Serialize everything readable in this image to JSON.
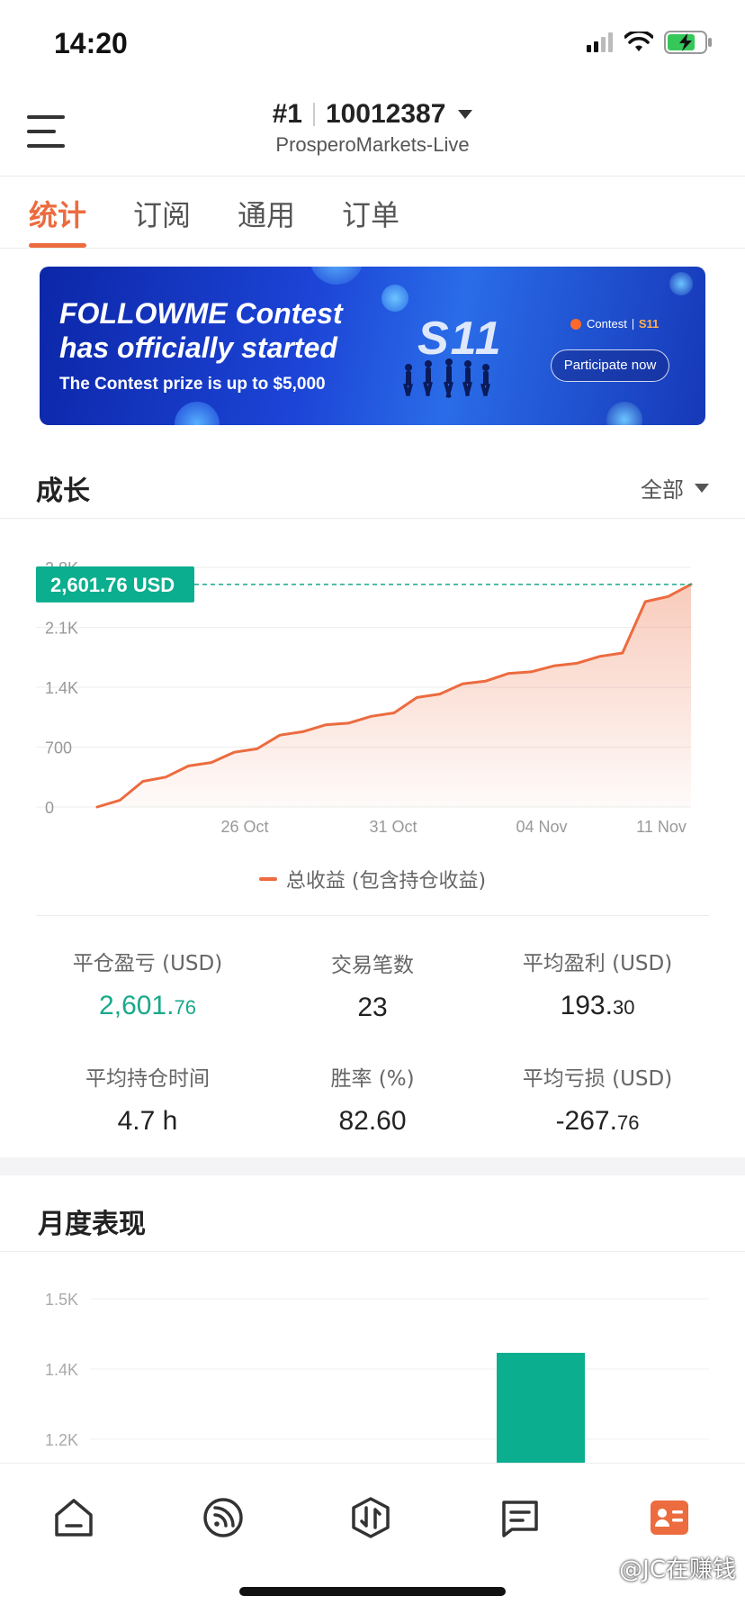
{
  "status_bar": {
    "time": "14:20"
  },
  "header": {
    "rank": "#1",
    "account_id": "10012387",
    "server": "ProsperoMarkets-Live"
  },
  "tabs": [
    {
      "label": "统计",
      "active": true
    },
    {
      "label": "订阅",
      "active": false
    },
    {
      "label": "通用",
      "active": false
    },
    {
      "label": "订单",
      "active": false
    }
  ],
  "banner": {
    "line1": "FOLLOWME Contest",
    "line2": "has officially started",
    "line3": "The Contest prize is up to $5,000",
    "badge_label": "Contest",
    "badge_season": "S11",
    "big_mark": "S11",
    "cta": "Participate now"
  },
  "growth": {
    "title": "成长",
    "filter": "全部",
    "legend": "总收益 (包含持仓收益)"
  },
  "chart_data": [
    {
      "type": "area",
      "y_ticks": [
        "2.8K",
        "2.1K",
        "1.4K",
        "700",
        "0"
      ],
      "y_tick_values": [
        2800,
        2100,
        1400,
        700,
        0
      ],
      "x_ticks": [
        "26 Oct",
        "31 Oct",
        "04 Nov",
        "11 Nov"
      ],
      "ylim": [
        0,
        2800
      ],
      "current_label": "2,601.76 USD",
      "current_value": 2601.76,
      "color": "#ec6b3f",
      "series": [
        {
          "name": "总收益 (包含持仓收益)",
          "values": [
            0,
            80,
            300,
            350,
            480,
            520,
            640,
            680,
            840,
            880,
            960,
            980,
            1060,
            1100,
            1280,
            1320,
            1440,
            1470,
            1560,
            1580,
            1650,
            1680,
            1760,
            1800,
            2400,
            2460,
            2601.76
          ]
        }
      ]
    },
    {
      "type": "bar",
      "y_ticks": [
        "1.5K",
        "1.4K",
        "1.2K"
      ],
      "y_tick_values": [
        1500,
        1400,
        1200
      ],
      "ylim": [
        1150,
        1550
      ],
      "color": "#0bae8e",
      "values": [
        1430
      ]
    }
  ],
  "stats": {
    "closed_pnl": {
      "label": "平仓盈亏 (USD)",
      "int": "2,601.",
      "frac": "76"
    },
    "trade_count": {
      "label": "交易笔数",
      "value": "23"
    },
    "avg_profit": {
      "label": "平均盈利 (USD)",
      "int": "193.",
      "frac": "30"
    },
    "avg_hold": {
      "label": "平均持仓时间",
      "value": "4.7 h"
    },
    "win_rate": {
      "label": "胜率 (%)",
      "value": "82.60"
    },
    "avg_loss": {
      "label": "平均亏损 (USD)",
      "int": "-267.",
      "frac": "76"
    }
  },
  "monthly": {
    "title": "月度表现"
  },
  "bottom_nav": {
    "items": [
      "home-icon",
      "feed-icon",
      "trade-icon",
      "message-icon",
      "profile-card-icon"
    ],
    "active_color": "#ec6b3f"
  },
  "watermark": "@JC在赚钱"
}
